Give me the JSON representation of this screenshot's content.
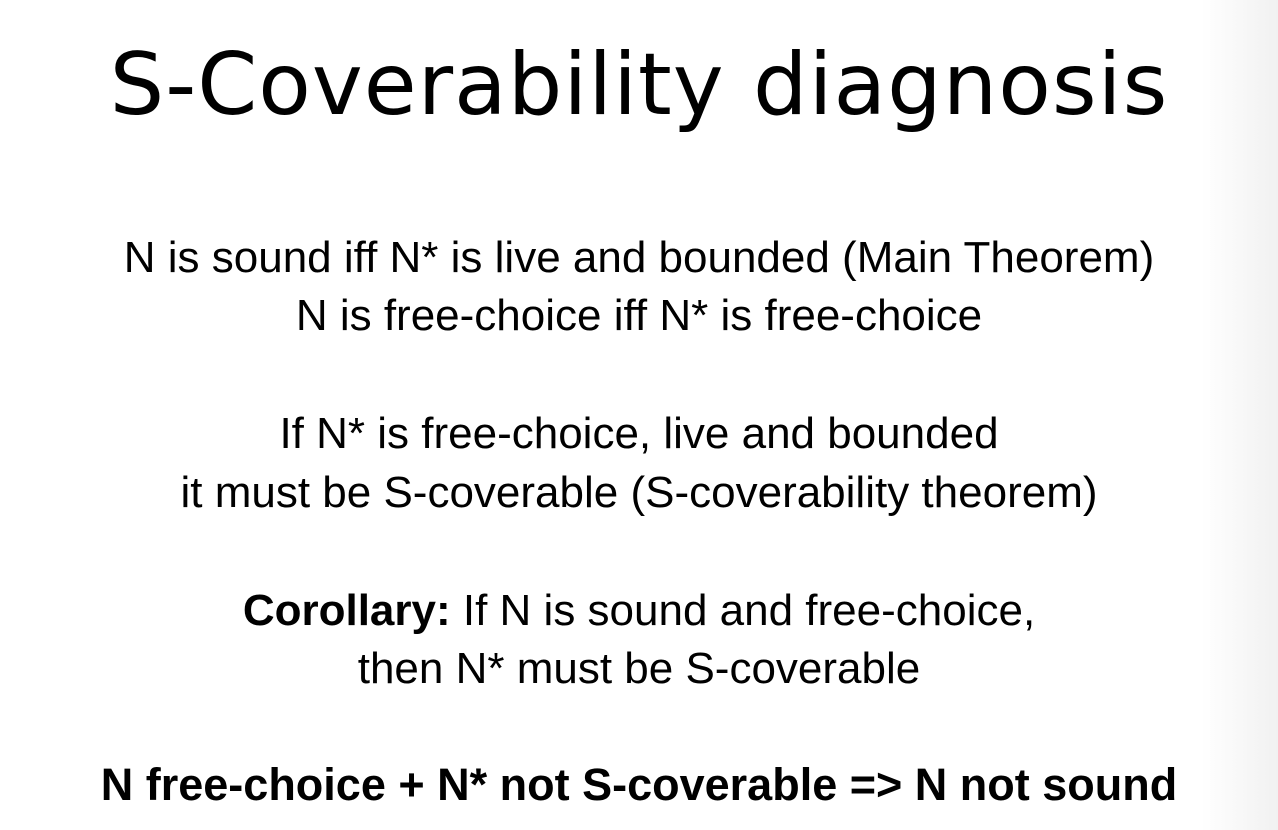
{
  "title": "S-Coverability diagnosis",
  "paragraph1": {
    "line1": "N is sound iff N* is live and bounded (Main Theorem)",
    "line2": "N is free-choice iff N* is free-choice"
  },
  "paragraph2": {
    "line1": "If N* is free-choice, live and bounded",
    "line2": "it must be S-coverable (S-coverability theorem)"
  },
  "corollary": {
    "label": "Corollary:",
    "line1_rest": " If N is sound and free-choice,",
    "line2": "then N* must be S-coverable"
  },
  "conclusion": "N free-choice + N* not S-coverable => N not sound"
}
